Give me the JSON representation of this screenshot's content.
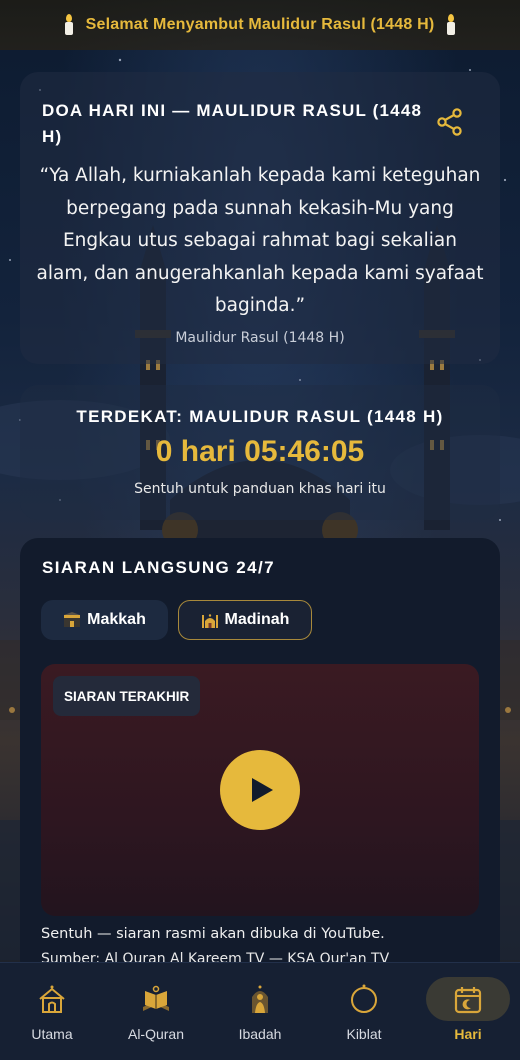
{
  "banner": {
    "title": "Selamat Menyambut Maulidur Rasul (1448 H)"
  },
  "doa": {
    "heading": "DOA HARI INI — MAULIDUR RASUL (1448 H)",
    "quote": "“Ya Allah, kurniakanlah kepada kami keteguhan berpegang pada sunnah kekasih-Mu yang Engkau utus sebagai rahmat bagi sekalian alam, dan anugerahkanlah kepada kami syafaat baginda.”",
    "source": "Maulidur Rasul (1448 H)",
    "share_icon": "share-icon"
  },
  "countdown": {
    "label": "TERDEKAT: MAULIDUR RASUL (1448 H)",
    "timer": "0 hari 05:46:05",
    "hint": "Sentuh untuk panduan khas hari itu"
  },
  "live": {
    "heading": "SIARAN LANGSUNG 24/7",
    "tabs": [
      {
        "label": "Makkah",
        "icon": "kaaba-icon"
      },
      {
        "label": "Madinah",
        "icon": "mosque-icon"
      }
    ],
    "selected_tab": "Madinah",
    "badge": "SIARAN TERAKHIR",
    "note": "Sentuh — siaran rasmi akan dibuka di YouTube.",
    "source": "Sumber: Al Quran Al Kareem TV — KSA Qur'an TV"
  },
  "nav": {
    "items": [
      {
        "label": "Utama",
        "icon": "home-icon"
      },
      {
        "label": "Al-Quran",
        "icon": "quran-icon"
      },
      {
        "label": "Ibadah",
        "icon": "prayer-icon"
      },
      {
        "label": "Kiblat",
        "icon": "compass-icon"
      },
      {
        "label": "Hari",
        "icon": "calendar-icon"
      }
    ],
    "active": "Hari"
  },
  "colors": {
    "accent": "#e6b93c",
    "card": "#121b2c",
    "nav": "#162033"
  }
}
